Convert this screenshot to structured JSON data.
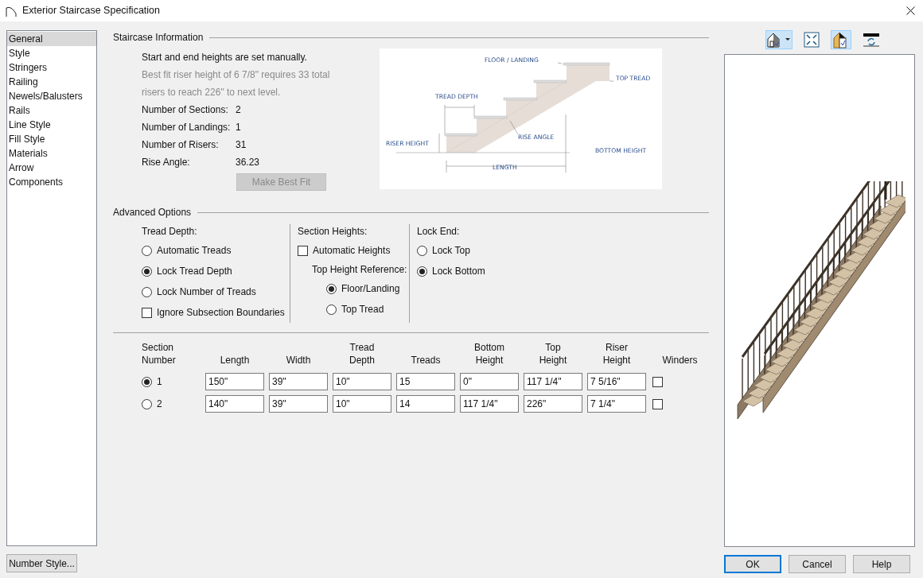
{
  "window": {
    "title": "Exterior Staircase Specification"
  },
  "sidebar": {
    "items": [
      {
        "label": "General",
        "selected": true
      },
      {
        "label": "Style",
        "selected": false
      },
      {
        "label": "Stringers",
        "selected": false
      },
      {
        "label": "Railing",
        "selected": false
      },
      {
        "label": "Newels/Balusters",
        "selected": false
      },
      {
        "label": "Rails",
        "selected": false
      },
      {
        "label": "Line Style",
        "selected": false
      },
      {
        "label": "Fill Style",
        "selected": false
      },
      {
        "label": "Materials",
        "selected": false
      },
      {
        "label": "Arrow",
        "selected": false
      },
      {
        "label": "Components",
        "selected": false
      }
    ]
  },
  "staircase_information": {
    "title": "Staircase Information",
    "status": "Start and end heights are set manually.",
    "hint_lines": [
      "Best fit riser height of 6 7/8\" requires 33 total",
      "risers to reach 226\" to next level."
    ],
    "stats": [
      {
        "label": "Number of Sections:",
        "value": "2"
      },
      {
        "label": "Number of Landings:",
        "value": "1"
      },
      {
        "label": "Number of Risers:",
        "value": "31"
      },
      {
        "label": "Rise Angle:",
        "value": "36.23"
      }
    ],
    "make_best_fit": {
      "label": "Make Best Fit",
      "disabled": true
    }
  },
  "diagram": {
    "labels": [
      "FLOOR / LANDING",
      "TOP TREAD",
      "TREAD DEPTH",
      "RISER HEIGHT",
      "RISE ANGLE",
      "BOTTOM HEIGHT",
      "LENGTH"
    ]
  },
  "advanced_options": {
    "title": "Advanced Options",
    "tread_depth": {
      "title": "Tread Depth:",
      "options": [
        {
          "label": "Automatic Treads",
          "selected": false
        },
        {
          "label": "Lock Tread Depth",
          "selected": true
        },
        {
          "label": "Lock Number of Treads",
          "selected": false
        }
      ],
      "ignore_subsection": {
        "label": "Ignore Subsection Boundaries",
        "checked": false
      }
    },
    "section_heights": {
      "title": "Section Heights:",
      "automatic_heights": {
        "label": "Automatic Heights",
        "checked": false
      },
      "reference_title": "Top Height Reference:",
      "options": [
        {
          "label": "Floor/Landing",
          "selected": true
        },
        {
          "label": "Top Tread",
          "selected": false
        }
      ]
    },
    "lock_end": {
      "title": "Lock End:",
      "options": [
        {
          "label": "Lock Top",
          "selected": false
        },
        {
          "label": "Lock Bottom",
          "selected": true
        }
      ]
    }
  },
  "sections": {
    "columns": [
      "Section\nNumber",
      "Length",
      "Width",
      "Tread\nDepth",
      "Treads",
      "Bottom\nHeight",
      "Top\nHeight",
      "Riser\nHeight",
      "Winders"
    ],
    "rows": [
      {
        "number": "1",
        "selected": true,
        "cells": [
          "150\"",
          "39\"",
          "10\"",
          "15",
          "0\"",
          "117 1/4\"",
          "7 5/16\""
        ],
        "winders": false
      },
      {
        "number": "2",
        "selected": false,
        "cells": [
          "140\"",
          "39\"",
          "10\"",
          "14",
          "117 1/4\"",
          "226\"",
          "7 1/4\""
        ],
        "winders": false
      }
    ]
  },
  "preview": {
    "toolbar": [
      {
        "kind": "view-menu",
        "selected": true
      },
      {
        "kind": "fit",
        "selected": false
      },
      {
        "kind": "material",
        "selected": true
      },
      {
        "kind": "refresh",
        "selected": false
      }
    ]
  },
  "number_style_button": "Number Style...",
  "footer_buttons": [
    "OK",
    "Cancel",
    "Help"
  ]
}
